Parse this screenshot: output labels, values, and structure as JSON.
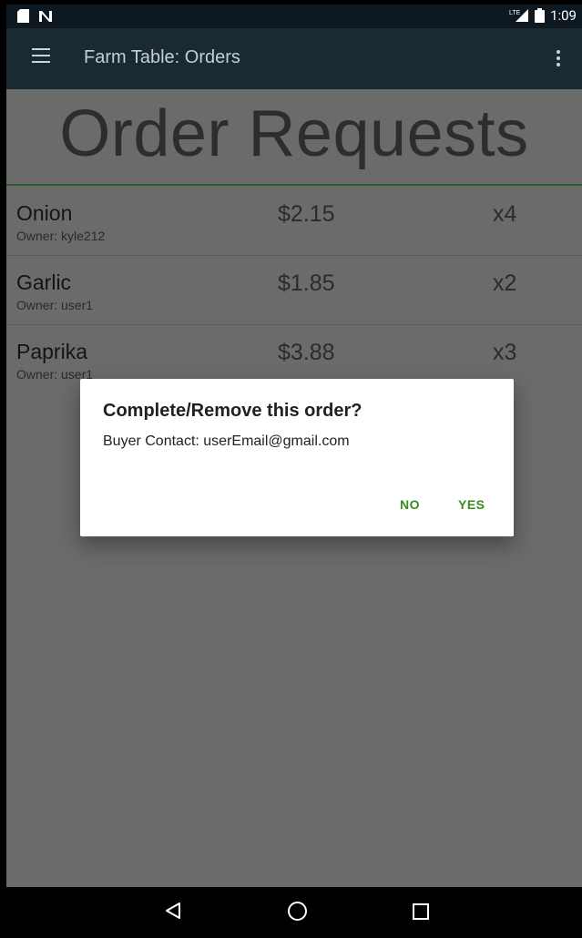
{
  "status_bar": {
    "time": "1:09",
    "network_label": "LTE"
  },
  "app_bar": {
    "title": "Farm Table: Orders"
  },
  "page": {
    "heading": "Order Requests"
  },
  "orders": [
    {
      "name": "Onion",
      "owner": "Owner: kyle212",
      "price": "$2.15",
      "qty": "x4"
    },
    {
      "name": "Garlic",
      "owner": "Owner: user1",
      "price": "$1.85",
      "qty": "x2"
    },
    {
      "name": "Paprika",
      "owner": "Owner: user1",
      "price": "$3.88",
      "qty": "x3"
    }
  ],
  "dialog": {
    "title": "Complete/Remove this order?",
    "message": "Buyer Contact: userEmail@gmail.com",
    "no_label": "NO",
    "yes_label": "YES"
  },
  "colors": {
    "app_bar": "#1a2a33",
    "scrim_content": "#6b6b6b",
    "accent_green": "#3a8a1e",
    "divider_green": "#2f5a2a"
  }
}
